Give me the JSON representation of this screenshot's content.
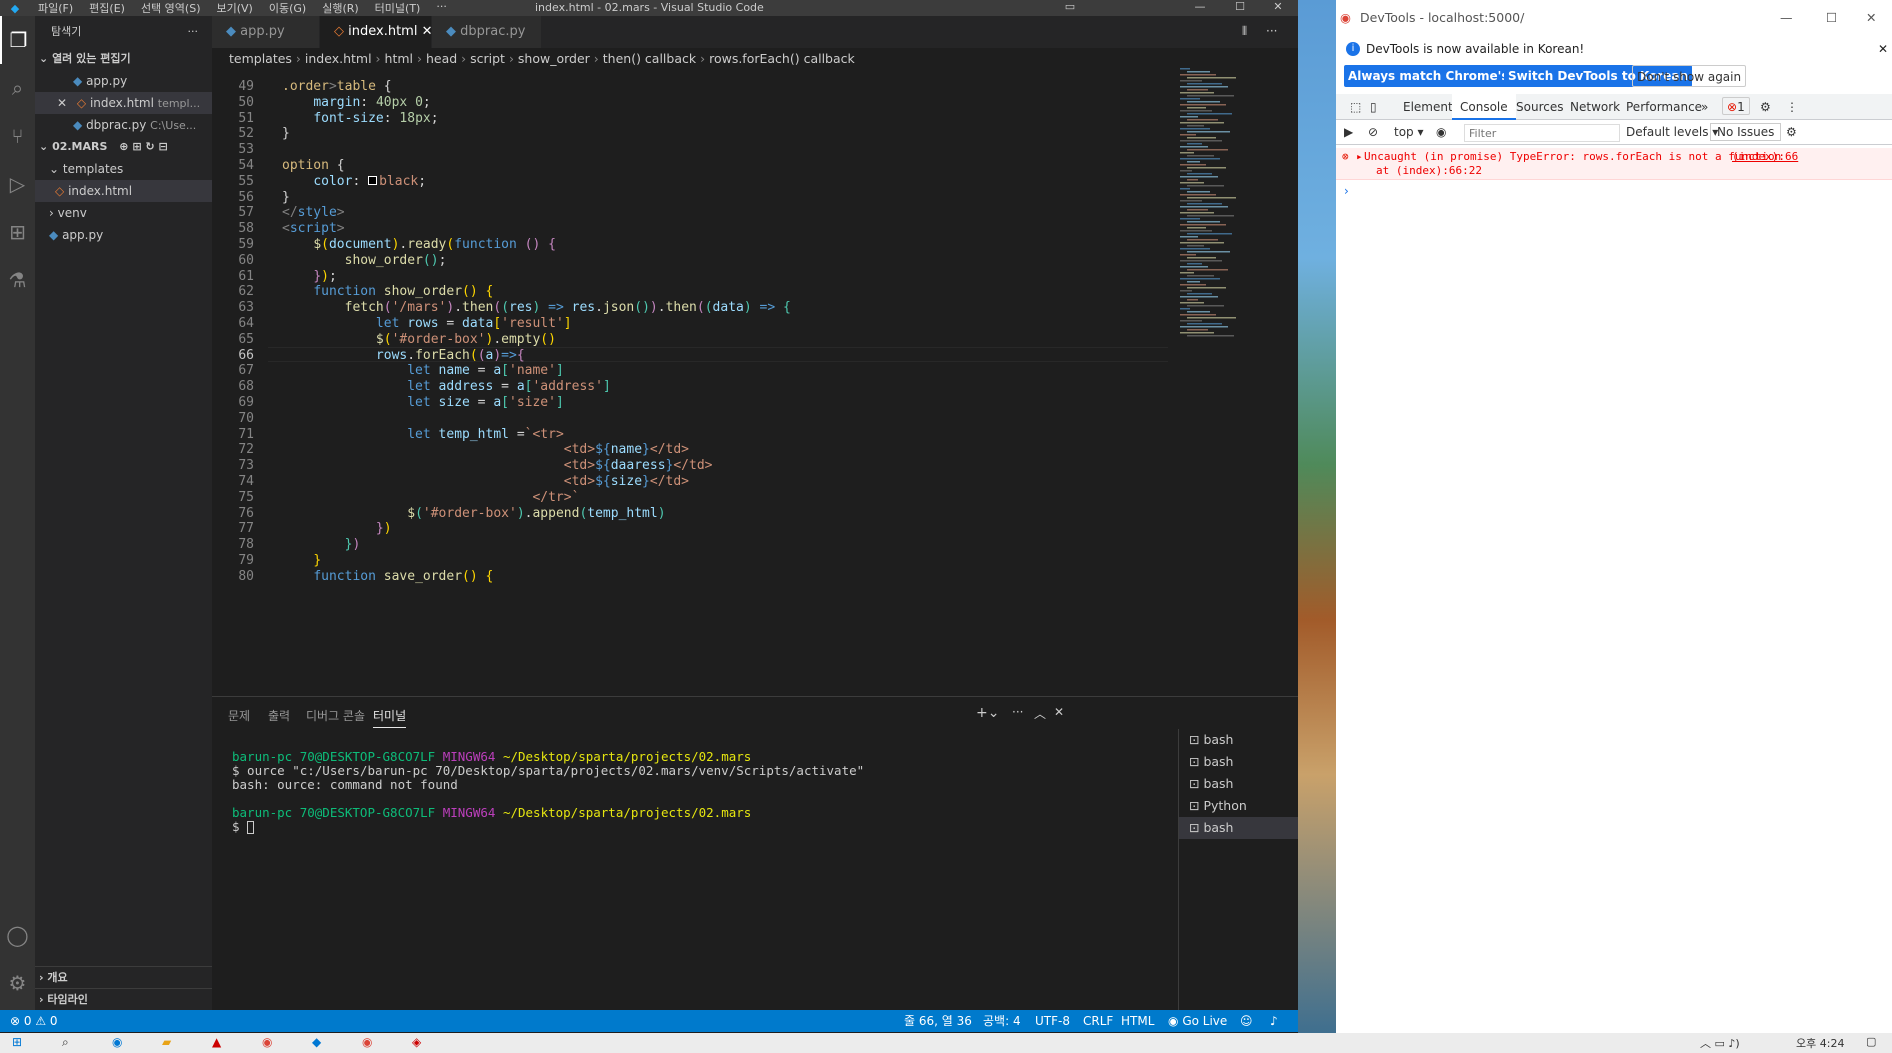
{
  "vscode": {
    "menu": [
      "파일(F)",
      "편집(E)",
      "선택 영역(S)",
      "보기(V)",
      "이동(G)",
      "실행(R)",
      "터미널(T)",
      "···"
    ],
    "window_title": "index.html - 02.mars - Visual Studio Code",
    "sidebar": {
      "header": "탐색기",
      "open_editors_label": "열려 있는 편집기",
      "open_editors": [
        {
          "name": "app.py",
          "hint": ""
        },
        {
          "name": "index.html",
          "hint": "templ..."
        },
        {
          "name": "dbprac.py",
          "hint": "C:\\Use..."
        }
      ],
      "project_label": "02.MARS",
      "tree": [
        {
          "name": "templates"
        },
        {
          "name": "index.html"
        },
        {
          "name": "venv"
        },
        {
          "name": "app.py"
        }
      ],
      "outline_label": "개요",
      "timeline_label": "타임라인"
    },
    "tabs": [
      "app.py",
      "index.html",
      "dbprac.py"
    ],
    "breadcrumb": [
      "templates",
      "index.html",
      "html",
      "head",
      "script",
      "show_order",
      "then() callback",
      "rows.forEach() callback"
    ],
    "code_lines": [
      {
        "n": "49",
        "html": "<span class='d'>.order</span><span class='t'>&gt;</span><span class='d'>table</span> {"
      },
      {
        "n": "50",
        "html": "    <span class='v'>margin</span>: <span class='n'>40px 0</span>;"
      },
      {
        "n": "51",
        "html": "    <span class='v'>font-size</span>: <span class='n'>18px</span>;"
      },
      {
        "n": "52",
        "html": "}"
      },
      {
        "n": "53",
        "html": ""
      },
      {
        "n": "54",
        "html": "<span class='d'>option</span> {"
      },
      {
        "n": "55",
        "html": "    <span class='v'>color</span>: <span style='display:inline-block;width:9px;height:9px;border:1px solid #fff;background:#000;margin-right:2px'></span><span class='s'>black</span>;"
      },
      {
        "n": "56",
        "html": "}"
      },
      {
        "n": "57",
        "html": "<span class='t'>&lt;/</span><span class='k'>style</span><span class='t'>&gt;</span>"
      },
      {
        "n": "58",
        "html": "<span class='t'>&lt;</span><span class='k'>script</span><span class='t'>&gt;</span>"
      },
      {
        "n": "59",
        "html": "    <span class='f'>$</span><span class='y'>(</span><span class='v'>document</span><span class='y'>)</span>.<span class='f'>ready</span><span class='y'>(</span><span class='k'>function</span> <span class='p'>()</span> <span class='p'>{</span>"
      },
      {
        "n": "60",
        "html": "        <span class='f'>show_order</span><span class='g'>()</span>;"
      },
      {
        "n": "61",
        "html": "    <span class='p'>}</span><span class='y'>)</span>;"
      },
      {
        "n": "62",
        "html": "    <span class='k'>function</span> <span class='f'>show_order</span><span class='y'>()</span> <span class='y'>{</span>"
      },
      {
        "n": "63",
        "html": "        <span class='f'>fetch</span><span class='p'>(</span><span class='s'>'/mars'</span><span class='p'>)</span>.<span class='f'>then</span><span class='p'>(</span><span class='g'>(</span><span class='v'>res</span><span class='g'>)</span> <span class='k'>=&gt;</span> <span class='v'>res</span>.<span class='f'>json</span><span class='g'>()</span><span class='p'>)</span>.<span class='f'>then</span><span class='p'>(</span><span class='g'>(</span><span class='v'>data</span><span class='g'>)</span> <span class='k'>=&gt;</span> <span class='g'>{</span>"
      },
      {
        "n": "64",
        "html": "            <span class='k'>let</span> <span class='v'>rows</span> = <span class='v'>data</span><span class='y'>[</span><span class='s'>'result'</span><span class='y'>]</span>"
      },
      {
        "n": "65",
        "html": "            <span class='f'>$</span><span class='y'>(</span><span class='s'>'#order-box'</span><span class='y'>)</span>.<span class='f'>empty</span><span class='y'>()</span>"
      },
      {
        "n": "66",
        "html": "            <span class='v'>rows</span>.<span class='f'>forEach</span><span class='y'>(</span><span class='p'>(</span><span class='v'>a</span><span class='p'>)</span><span class='k'>=&gt;</span><span class='p'>{</span>"
      },
      {
        "n": "67",
        "html": "                <span class='k'>let</span> <span class='v'>name</span> = <span class='v'>a</span><span class='g'>[</span><span class='s'>'name'</span><span class='g'>]</span>"
      },
      {
        "n": "68",
        "html": "                <span class='k'>let</span> <span class='v'>address</span> = <span class='v'>a</span><span class='g'>[</span><span class='s'>'address'</span><span class='g'>]</span>"
      },
      {
        "n": "69",
        "html": "                <span class='k'>let</span> <span class='v'>size</span> = <span class='v'>a</span><span class='g'>[</span><span class='s'>'size'</span><span class='g'>]</span>"
      },
      {
        "n": "70",
        "html": ""
      },
      {
        "n": "71",
        "html": "                <span class='k'>let</span> <span class='v'>temp_html</span> =<span class='s'>`&lt;tr&gt;</span>"
      },
      {
        "n": "72",
        "html": "                                    <span class='s'>&lt;td&gt;</span><span class='k'>${</span><span class='v'>name</span><span class='k'>}</span><span class='s'>&lt;/td&gt;</span>"
      },
      {
        "n": "73",
        "html": "                                    <span class='s'>&lt;td&gt;</span><span class='k'>${</span><span class='v'>daaress</span><span class='k'>}</span><span class='s'>&lt;/td&gt;</span>"
      },
      {
        "n": "74",
        "html": "                                    <span class='s'>&lt;td&gt;</span><span class='k'>${</span><span class='v'>size</span><span class='k'>}</span><span class='s'>&lt;/td&gt;</span>"
      },
      {
        "n": "75",
        "html": "                                <span class='s'>&lt;/tr&gt;`</span>"
      },
      {
        "n": "76",
        "html": "                <span class='f'>$</span><span class='g'>(</span><span class='s'>'#order-box'</span><span class='g'>)</span>.<span class='f'>append</span><span class='g'>(</span><span class='v'>temp_html</span><span class='g'>)</span>"
      },
      {
        "n": "77",
        "html": "            <span class='p'>}</span><span class='y'>)</span>"
      },
      {
        "n": "78",
        "html": "        <span class='g'>}</span><span class='p'>)</span>"
      },
      {
        "n": "79",
        "html": "    <span class='y'>}</span>"
      },
      {
        "n": "80",
        "html": "    <span class='k'>function</span> <span class='f'>save_order</span><span class='y'>()</span> <span class='y'>{</span>"
      }
    ],
    "current_line": "66",
    "panel_tabs": [
      "문제",
      "출력",
      "디버그 콘솔",
      "터미널"
    ],
    "terminal": {
      "prompt_user": "barun-pc 70@DESKTOP-G8CO7LF",
      "prompt_shell": "MINGW64",
      "prompt_path": "~/Desktop/sparta/projects/02.mars",
      "command": "$ ource \"c:/Users/barun-pc 70/Desktop/sparta/projects/02.mars/venv/Scripts/activate\"",
      "error": "bash: ource: command not found",
      "last_prompt": "$ "
    },
    "terminal_list": [
      "bash",
      "bash",
      "bash",
      "Python",
      "bash"
    ],
    "status": {
      "problems": "⊗ 0 ⚠ 0",
      "position": "줄 66, 열 36",
      "spaces": "공백: 4",
      "encoding": "UTF-8",
      "eol": "CRLF",
      "language": "HTML",
      "golive": "Go Live"
    }
  },
  "devtools": {
    "window_title": "DevTools - localhost:5000/",
    "info_text": "DevTools is now available in Korean!",
    "btn_match": "Always match Chrome's language",
    "btn_switch": "Switch DevTools to Korean",
    "btn_dismiss": "Don't show again",
    "tabs": [
      "Elements",
      "Console",
      "Sources",
      "Network",
      "Performance"
    ],
    "error_count": "1",
    "context": "top",
    "filter_placeholder": "Filter",
    "levels": "Default levels",
    "issues": "No Issues",
    "error_message": "Uncaught (in promise) TypeError: rows.forEach is not a function",
    "error_source": "(index):66",
    "error_at": "at (index):66:22"
  },
  "taskbar": {
    "time": "오후 4:24"
  },
  "colors": {
    "accent": "#007acc",
    "error": "#e51400"
  }
}
